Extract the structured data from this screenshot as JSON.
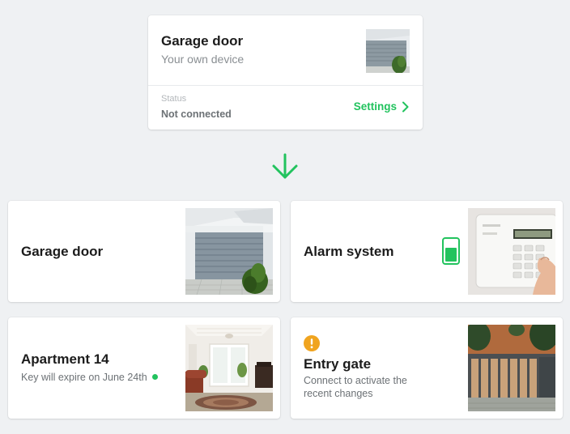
{
  "device": {
    "title": "Garage door",
    "subtitle": "Your own device",
    "status_label": "Status",
    "status_value": "Not connected",
    "settings_label": "Settings",
    "image_icon": "garage-photo"
  },
  "tiles": [
    {
      "title": "Garage door",
      "image_icon": "garage-photo"
    },
    {
      "title": "Alarm system",
      "status_icon": "battery-icon",
      "image_icon": "alarm-keypad-photo"
    },
    {
      "title": "Apartment 14",
      "subtitle": "Key will expire on June 24th",
      "status_icon": "online-dot",
      "image_icon": "apartment-interior-photo"
    },
    {
      "title": "Entry gate",
      "subtitle_line1": "Connect to activate the",
      "subtitle_line2": "recent changes",
      "status_icon": "warning-icon",
      "image_icon": "entry-gate-photo"
    }
  ],
  "colors": {
    "accent": "#22c35e",
    "warning": "#f0a41f",
    "background": "#eff1f3"
  }
}
